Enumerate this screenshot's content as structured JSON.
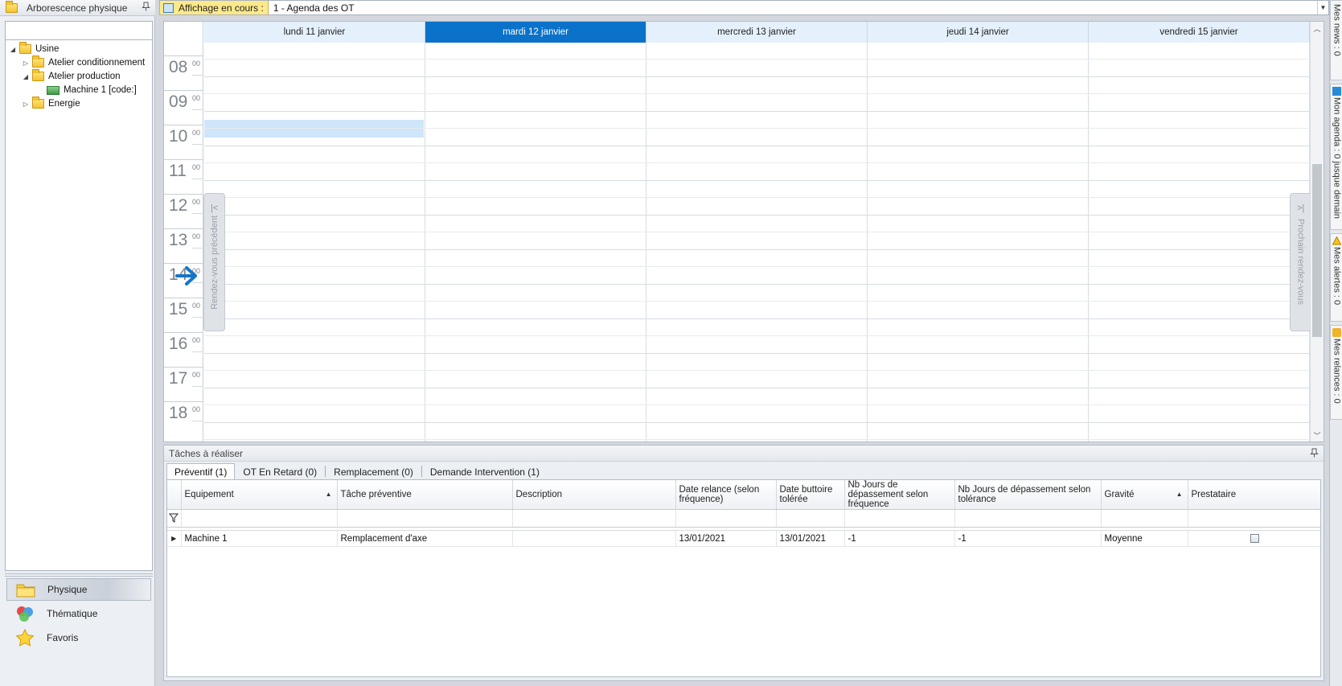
{
  "left_panel": {
    "title": "Arborescence physique",
    "search_value": "",
    "tree": [
      {
        "label": "Usine",
        "toggle": "◢",
        "level": 0,
        "icon": "folder-icon"
      },
      {
        "label": "Atelier conditionnement",
        "toggle": "▷",
        "level": 1,
        "icon": "folder-icon"
      },
      {
        "label": "Atelier production",
        "toggle": "◢",
        "level": 1,
        "icon": "folder-icon"
      },
      {
        "label": "Machine 1 [code:]",
        "toggle": "",
        "level": 2,
        "icon": "machine-icon"
      },
      {
        "label": "Energie",
        "toggle": "▷",
        "level": 1,
        "icon": "folder-icon"
      }
    ],
    "nav_buttons": [
      {
        "label": "Physique",
        "icon": "folder-icon",
        "active": true
      },
      {
        "label": "Thématique",
        "icon": "circles-icon",
        "active": false
      },
      {
        "label": "Favoris",
        "icon": "star-icon",
        "active": false
      }
    ]
  },
  "topbar": {
    "label": "Affichage en cours :",
    "value": "1 - Agenda des OT"
  },
  "calendar": {
    "days": [
      {
        "label": "lundi 11 janvier",
        "today": false
      },
      {
        "label": "mardi 12 janvier",
        "today": true
      },
      {
        "label": "mercredi 13 janvier",
        "today": false
      },
      {
        "label": "jeudi 14 janvier",
        "today": false
      },
      {
        "label": "vendredi 15 janvier",
        "today": false
      }
    ],
    "hours": [
      "08",
      "09",
      "10",
      "11",
      "12",
      "13",
      "14",
      "15",
      "16",
      "17",
      "18"
    ],
    "minutes_label": "00",
    "prev_label": "Rendez-vous précédent",
    "next_label": "Prochain rendez-vous",
    "prev_chevron": "|<",
    "next_chevron": ">|",
    "accent_color": "#0a72c9",
    "highlight_color": "#cfe5f9"
  },
  "right_tabs": [
    {
      "label": "Mes news : 0",
      "icon": "news-icon"
    },
    {
      "label": "Mon agenda : 0 jusque demain",
      "icon": "calendar-icon"
    },
    {
      "label": "Mes alertes : 0",
      "icon": "warning-icon"
    },
    {
      "label": "Mes relances : 0",
      "icon": "reminder-icon"
    }
  ],
  "tasks": {
    "title": "Tâches à réaliser",
    "tabs": [
      {
        "label": "Préventif (1)",
        "active": true
      },
      {
        "label": "OT En Retard (0)",
        "active": false
      },
      {
        "label": "Remplacement (0)",
        "active": false
      },
      {
        "label": "Demande Intervention (1)",
        "active": false
      }
    ],
    "columns": [
      {
        "label": "Equipement",
        "sort": "▲"
      },
      {
        "label": "Tâche préventive",
        "sort": ""
      },
      {
        "label": "Description",
        "sort": ""
      },
      {
        "label": "Date relance (selon fréquence)",
        "sort": ""
      },
      {
        "label": "Date buttoire tolérée",
        "sort": ""
      },
      {
        "label": "Nb Jours de dépassement selon fréquence",
        "sort": ""
      },
      {
        "label": "Nb Jours de dépassement selon tolérance",
        "sort": ""
      },
      {
        "label": "Gravité",
        "sort": "▲"
      },
      {
        "label": "Prestataire",
        "sort": ""
      }
    ],
    "rows": [
      {
        "equipement": "Machine 1",
        "tache": "Remplacement d'axe",
        "description": "",
        "date_relance": "13/01/2021",
        "date_buttoire": "13/01/2021",
        "nb_jours_frequence": "-1",
        "nb_jours_tolerance": "-1",
        "gravite": "Moyenne",
        "prestataire": false
      }
    ]
  }
}
